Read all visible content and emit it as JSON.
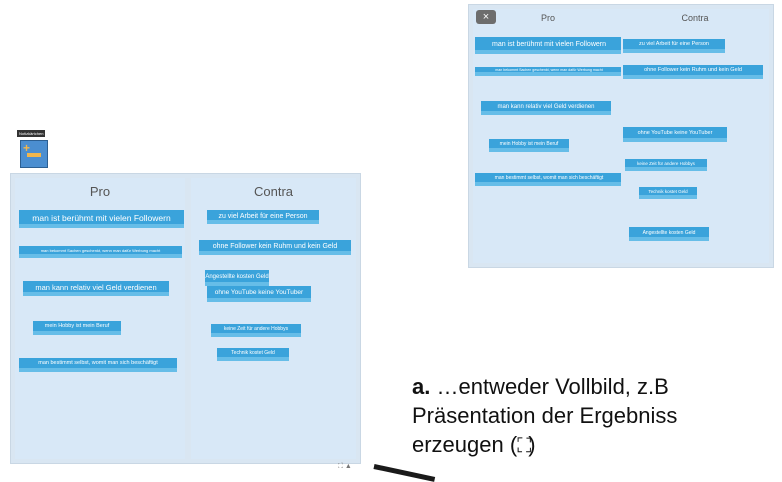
{
  "app": {
    "mini_label": "Notizkärtchen"
  },
  "board_large": {
    "pro_header": "Pro",
    "contra_header": "Contra",
    "pro_notes": [
      "man ist berühmt mit vielen Followern",
      "man bekommt Sachen geschenkt, wenn man dafür Werbung macht",
      "man kann relativ viel Geld verdienen",
      "mein Hobby ist mein Beruf",
      "man bestimmt selbst, womit man sich beschäftigt"
    ],
    "contra_notes": [
      "zu viel Arbeit für eine Person",
      "ohne Follower kein Ruhm und kein Geld",
      "Angestellte kosten Geld",
      "ohne YouTube keine YouTuber",
      "keine Zeit für andere Hobbys",
      "Technik kostet Geld"
    ]
  },
  "board_small": {
    "close_label": "×",
    "pro_header": "Pro",
    "contra_header": "Contra",
    "pro_notes": [
      "man ist berühmt mit vielen Followern",
      "man bekommt Sachen geschenkt, wenn man dafür Werbung macht",
      "man kann relativ viel Geld verdienen",
      "mein Hobby ist mein Beruf",
      "man bestimmt selbst, womit man sich beschäftigt"
    ],
    "contra_notes": [
      "zu viel Arbeit für eine Person",
      "ohne Follower kein Ruhm und kein Geld",
      "ohne YouTube keine YouTuber",
      "keine Zeit für andere Hobbys",
      "Technik kostet Geld",
      "Angestellte kosten Geld"
    ]
  },
  "caption": {
    "marker": "a.",
    "line1": " …entweder Vollbild, z.B",
    "line2": "Präsentation der Ergebniss",
    "line3_prefix": "erzeugen (",
    "line3_suffix": ")"
  },
  "corner_icons": "⛶ ▲",
  "colors": {
    "note": "#3aa3db",
    "column": "#d8e8f7",
    "board": "#d9e6f2"
  }
}
